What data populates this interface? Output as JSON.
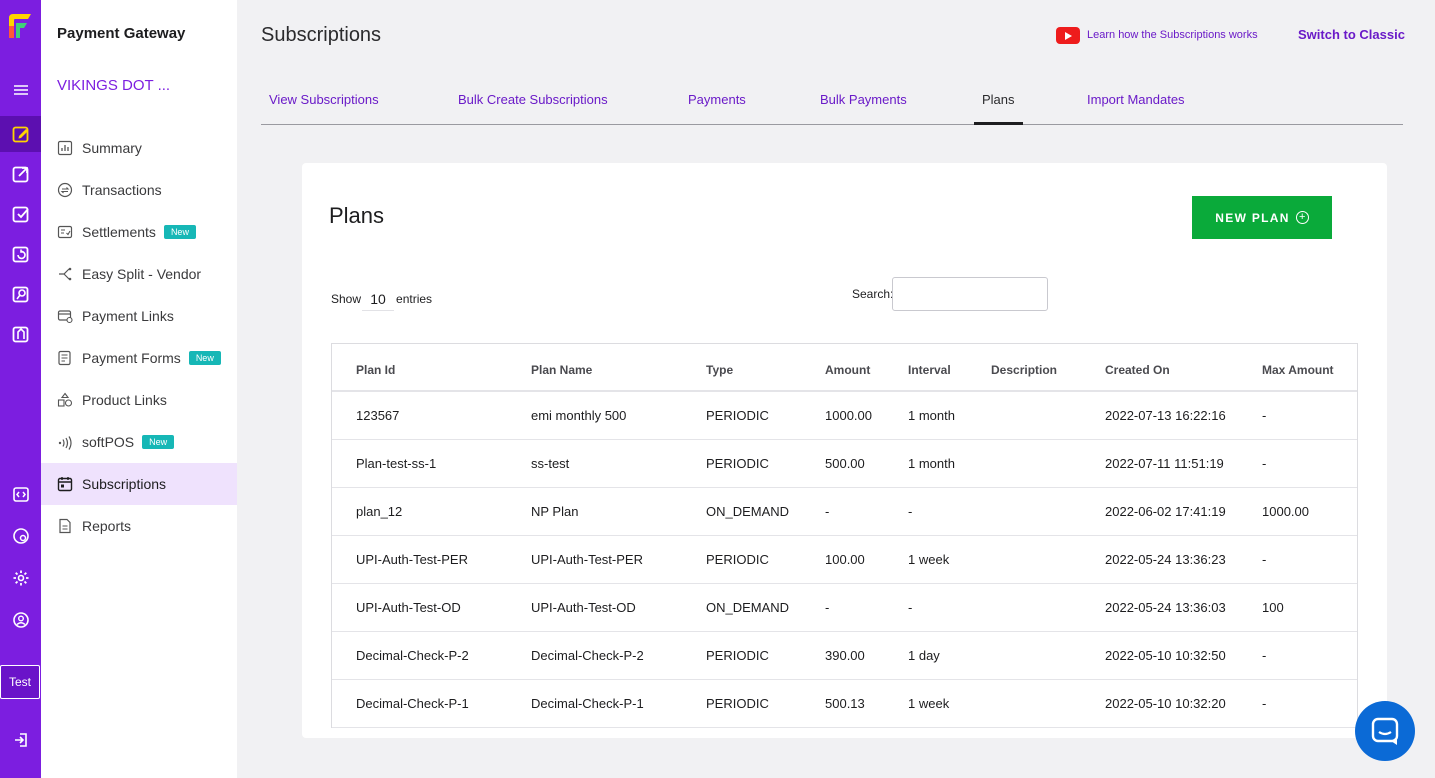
{
  "nav": {
    "product": "Payment Gateway",
    "merchant": "VIKINGS DOT ...",
    "items": [
      {
        "label": "Summary"
      },
      {
        "label": "Transactions"
      },
      {
        "label": "Settlements",
        "badge": "New"
      },
      {
        "label": "Easy Split - Vendor"
      },
      {
        "label": "Payment Links"
      },
      {
        "label": "Payment Forms",
        "badge": "New"
      },
      {
        "label": "Product Links"
      },
      {
        "label": "softPOS",
        "badge": "New"
      },
      {
        "label": "Subscriptions"
      },
      {
        "label": "Reports"
      }
    ]
  },
  "rail": {
    "mode_badge": "Test",
    "active_color": "#5c0fb0",
    "brand_color": "#7c1ee0"
  },
  "header": {
    "title": "Subscriptions",
    "learn_link": "Learn how the Subscriptions works",
    "switch_classic": "Switch to Classic"
  },
  "tabs": [
    {
      "label": "View Subscriptions"
    },
    {
      "label": "Bulk Create Subscriptions"
    },
    {
      "label": "Payments"
    },
    {
      "label": "Bulk Payments"
    },
    {
      "label": "Plans"
    },
    {
      "label": "Import Mandates"
    }
  ],
  "card": {
    "title": "Plans",
    "new_plan_label": "NEW PLAN",
    "show_label": "Show",
    "entries_value": "10",
    "entries_label": "entries",
    "search_label": "Search:",
    "search_value": ""
  },
  "table": {
    "columns": [
      "Plan Id",
      "Plan Name",
      "Type",
      "Amount",
      "Interval",
      "Description",
      "Created On",
      "Max Amount"
    ],
    "rows": [
      [
        "123567",
        "emi monthly 500",
        "PERIODIC",
        "1000.00",
        "1 month",
        "",
        "2022-07-13 16:22:16",
        "-"
      ],
      [
        "Plan-test-ss-1",
        "ss-test",
        "PERIODIC",
        "500.00",
        "1 month",
        "",
        "2022-07-11 11:51:19",
        "-"
      ],
      [
        "plan_12",
        "NP Plan",
        "ON_DEMAND",
        "-",
        "-",
        "",
        "2022-06-02 17:41:19",
        "1000.00"
      ],
      [
        "UPI-Auth-Test-PER",
        "UPI-Auth-Test-PER",
        "PERIODIC",
        "100.00",
        "1 week",
        "",
        "2022-05-24 13:36:23",
        "-"
      ],
      [
        "UPI-Auth-Test-OD",
        "UPI-Auth-Test-OD",
        "ON_DEMAND",
        "-",
        "-",
        "",
        "2022-05-24 13:36:03",
        "100"
      ],
      [
        "Decimal-Check-P-2",
        "Decimal-Check-P-2",
        "PERIODIC",
        "390.00",
        "1 day",
        "",
        "2022-05-10 10:32:50",
        "-"
      ],
      [
        "Decimal-Check-P-1",
        "Decimal-Check-P-1",
        "PERIODIC",
        "500.13",
        "1 week",
        "",
        "2022-05-10 10:32:20",
        "-"
      ]
    ]
  },
  "colors": {
    "accent": "#7c1ee0",
    "link": "#6a1ac8",
    "button_green": "#0aaa3a",
    "badge_teal": "#16b7b6",
    "chat_blue": "#0b6ad6"
  },
  "icons": [
    "cashfree-logo",
    "menu-icon",
    "payment-gateway-icon",
    "payouts-icon",
    "verification-icon",
    "subscriptions-icon",
    "payment-links-icon",
    "forms-icon",
    "developer-icon",
    "help-icon",
    "settings-icon",
    "profile-icon",
    "logout-icon",
    "youtube-icon",
    "plus-circle-icon",
    "chat-icon"
  ]
}
